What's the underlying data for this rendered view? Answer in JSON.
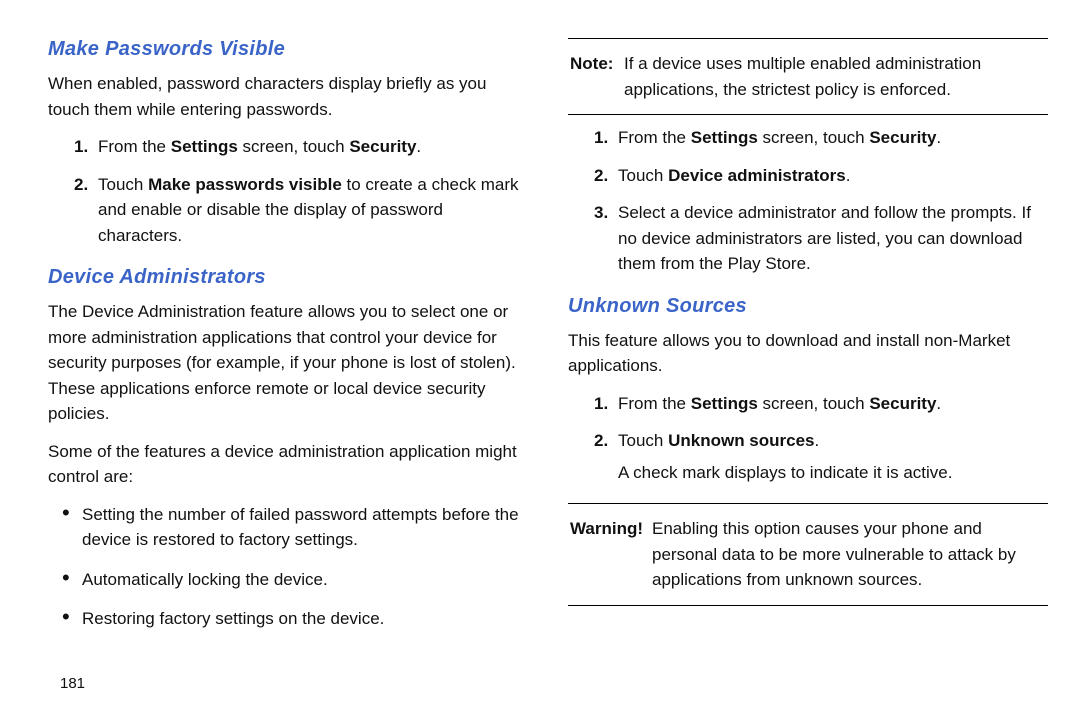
{
  "pageNumber": "181",
  "left": {
    "h1": "Make Passwords Visible",
    "p1": "When enabled, password characters display briefly as you touch them while entering passwords.",
    "steps1": [
      {
        "pre": "From the ",
        "b1": "Settings",
        "mid": " screen, touch ",
        "b2": "Security",
        "post": "."
      },
      {
        "pre": "Touch ",
        "b1": "Make passwords visible",
        "mid": " to create a check mark and enable or disable the display of password characters.",
        "b2": "",
        "post": ""
      }
    ],
    "h2": "Device Administrators",
    "p2": "The Device Administration feature allows you to select one or more administration applications that control your device for security purposes (for example, if your phone is lost of stolen). These applications enforce remote or local device security policies.",
    "p3": "Some of the features a device administration application might control are:",
    "bullets": [
      "Setting the number of failed password attempts before the device is restored to factory settings.",
      "Automatically locking the device.",
      "Restoring factory settings on the device."
    ]
  },
  "right": {
    "noteLabel": "Note:",
    "noteText": "If a device uses multiple enabled administration applications, the strictest policy is enforced.",
    "steps1": [
      {
        "pre": "From the ",
        "b1": "Settings",
        "mid": " screen, touch ",
        "b2": "Security",
        "post": "."
      },
      {
        "pre": "Touch ",
        "b1": "Device administrators",
        "mid": ".",
        "b2": "",
        "post": ""
      },
      {
        "pre": "Select a device administrator and follow the prompts. If no device administrators are listed, you can download them from the Play Store.",
        "b1": "",
        "mid": "",
        "b2": "",
        "post": ""
      }
    ],
    "h1": "Unknown Sources",
    "p1": "This feature allows you to download and install non-Market applications.",
    "steps2": [
      {
        "pre": "From the ",
        "b1": "Settings",
        "mid": " screen, touch ",
        "b2": "Security",
        "post": "."
      },
      {
        "pre": "Touch ",
        "b1": "Unknown sources",
        "mid": ".",
        "b2": "",
        "post": "",
        "after": "A check mark displays to indicate it is active."
      }
    ],
    "warnLabel": "Warning!",
    "warnText": "Enabling this option causes your phone and personal data to be more vulnerable to attack by applications from unknown sources."
  }
}
